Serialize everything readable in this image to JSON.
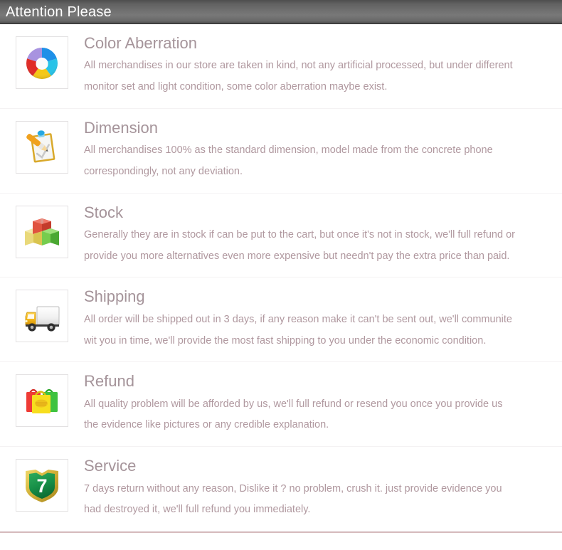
{
  "header": {
    "title": "Attention Please",
    "bg_dark": "#4e4e4e",
    "bg_light": "#787878",
    "text_color": "#ffffff"
  },
  "theme": {
    "title_color": "#a5949a",
    "body_color": "#b0989f",
    "divider_color": "#f4f2f3",
    "icon_frame_border": "#e3e1e2",
    "page_bg": "#ffffff",
    "bottom_rule_color": "#c9a6a8"
  },
  "sections": [
    {
      "id": "color-aberration",
      "icon": "color-wheel-icon",
      "title": "Color Aberration",
      "lines": [
        "All merchandises in our store are taken in kind, not any artificial processed, but under different",
        "monitor set and light condition, some color aberration maybe exist."
      ]
    },
    {
      "id": "dimension",
      "icon": "clipboard-pencil-icon",
      "title": "Dimension",
      "lines": [
        "All merchandises 100% as the standard dimension, model made from the concrete phone",
        "correspondingly, not any deviation."
      ]
    },
    {
      "id": "stock",
      "icon": "boxes-icon",
      "title": "Stock",
      "lines": [
        "Generally they are in stock if can be put to the cart, but once it's not in stock, we'll full refund or",
        "provide you more alternatives even more expensive but needn't pay the extra price than paid."
      ]
    },
    {
      "id": "shipping",
      "icon": "delivery-truck-icon",
      "title": "Shipping",
      "lines": [
        "All order will be shipped out in 3 days, if any reason make it can't be sent out, we'll communite",
        "wit you in time, we'll provide the most fast shipping to you under the economic condition."
      ]
    },
    {
      "id": "refund",
      "icon": "shopping-bags-icon",
      "title": "Refund",
      "lines": [
        "All quality problem will be afforded by us, we'll full refund or resend you once you provide us",
        "the evidence like pictures or any credible explanation."
      ]
    },
    {
      "id": "service",
      "icon": "shield-seven-icon",
      "title": "Service",
      "lines": [
        "7 days return without any reason, Dislike it ? no problem, crush it. just provide evidence you",
        "had destroyed it, we'll full refund you immediately."
      ]
    }
  ],
  "icon_colors": {
    "wheel_blue": "#1e90e8",
    "wheel_cyan": "#27c3e8",
    "wheel_yellow": "#f5c816",
    "wheel_red": "#e02b26",
    "wheel_purple": "#a893e0",
    "box_red": "#e0533f",
    "box_yellow": "#ead06a",
    "box_green": "#5cbd3e",
    "truck_cab": "#f2b418",
    "truck_body": "#f2f2f2",
    "bag_red": "#ef3b35",
    "bag_green": "#3fc23f",
    "bag_yellow": "#f7de1e",
    "shield_green": "#179048",
    "shield_gold": "#d2b139",
    "clip_gold": "#d9a92b",
    "clip_paper": "#f4f4f4",
    "clip_pencil": "#f0a11e",
    "clip_clip_blue": "#27a8e0"
  }
}
